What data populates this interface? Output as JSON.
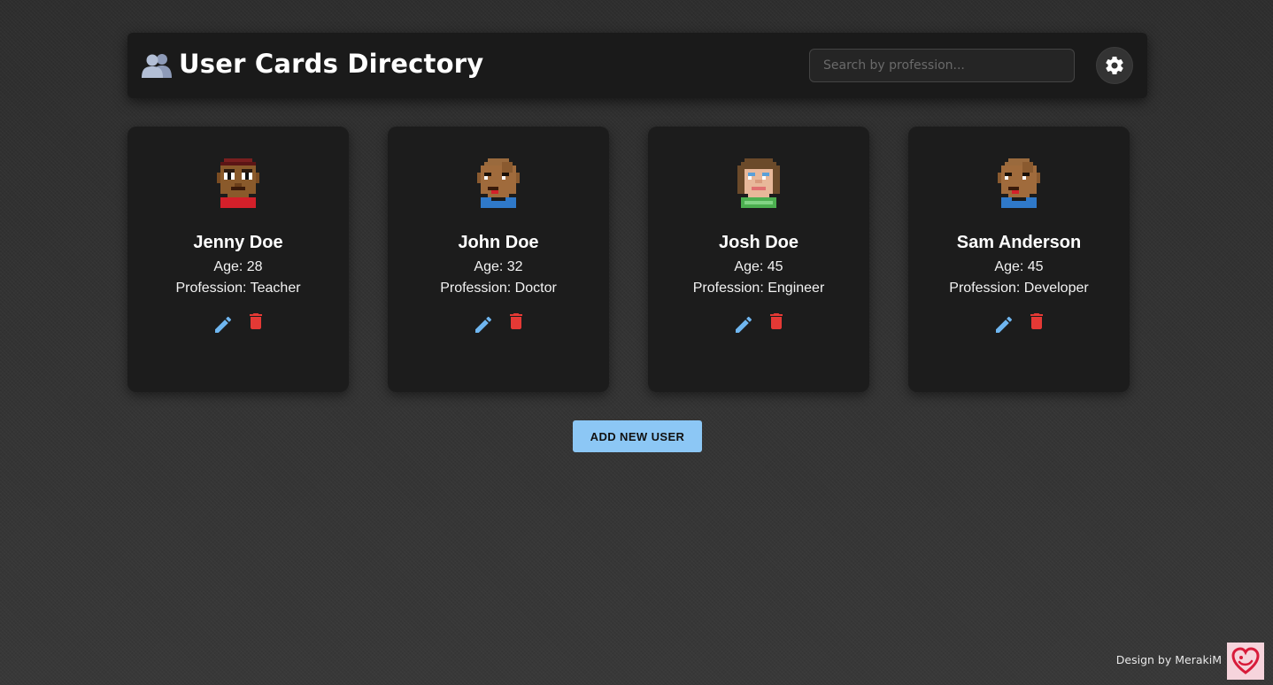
{
  "header": {
    "title": "User Cards Directory",
    "title_icon": "users-icon"
  },
  "search": {
    "placeholder": "Search by profession...",
    "value": ""
  },
  "theme_toggle": {
    "icon": "gear-icon"
  },
  "users": [
    {
      "name": "Jenny Doe",
      "age": "Age: 28",
      "profession": "Profession: Teacher",
      "avatar": "pixel-avatar-red-shirt"
    },
    {
      "name": "John Doe",
      "age": "Age: 32",
      "profession": "Profession: Doctor",
      "avatar": "pixel-avatar-blue-shirt"
    },
    {
      "name": "Josh Doe",
      "age": "Age: 45",
      "profession": "Profession: Engineer",
      "avatar": "pixel-avatar-green-shirt"
    },
    {
      "name": "Sam Anderson",
      "age": "Age: 45",
      "profession": "Profession: Developer",
      "avatar": "pixel-avatar-blue-shirt"
    }
  ],
  "actions": {
    "edit_icon": "pencil-icon",
    "delete_icon": "trash-icon",
    "add_user_label": "ADD NEW USER"
  },
  "footer": {
    "credit": "Design by MerakiM",
    "logo": "merakim-logo"
  },
  "colors": {
    "accent": "#8cc7f5",
    "edit": "#6fb6f0",
    "delete": "#e53935",
    "card_bg": "#1c1c1c",
    "header_bg": "#1a1a1a"
  }
}
